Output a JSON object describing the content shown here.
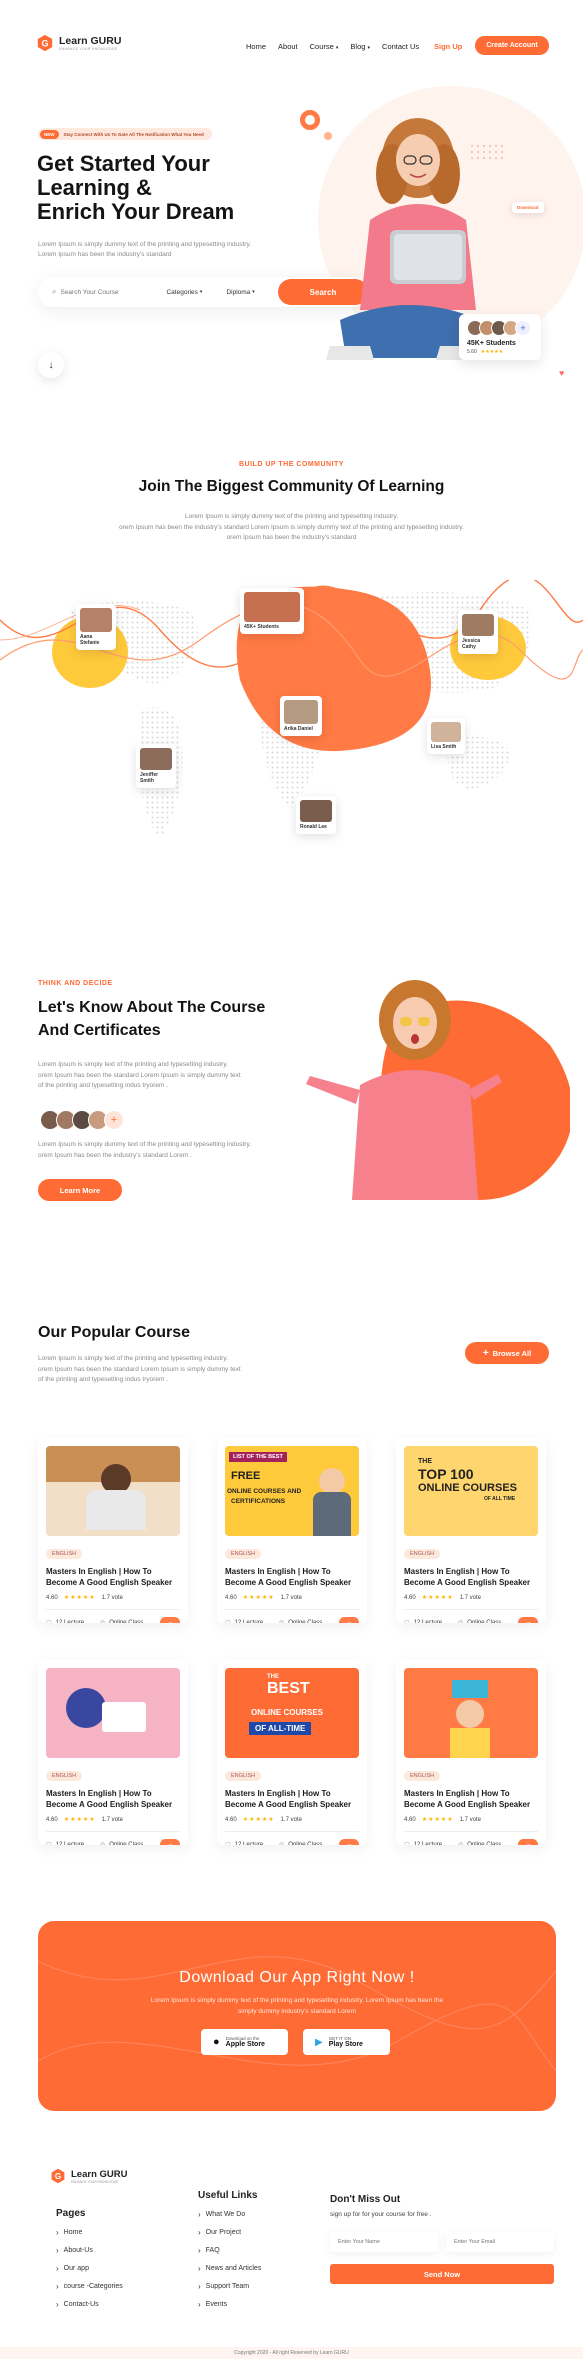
{
  "brand": {
    "name": "Learn GURU",
    "tagline": "ENHANCE YOUR KNOWLEDGE"
  },
  "nav": {
    "items": [
      {
        "label": "Home"
      },
      {
        "label": "About"
      },
      {
        "label": "Course",
        "dropdown": true
      },
      {
        "label": "Blog",
        "dropdown": true
      },
      {
        "label": "Contact Us"
      }
    ],
    "signup": "Sign Up",
    "create_account": "Create Account"
  },
  "hero": {
    "pill_tag": "NEW",
    "pill_text": "Stay Connect With Us To Gate All The Notification What You Need",
    "title_line1": "Get Started Your",
    "title_line2": "Learning &",
    "title_line3": "Enrich Your Dream",
    "desc_line1": "Lorem Ipsum is simply dummy text of the printing and typesetting industry.",
    "desc_line2": "Lorem Ipsum has been the industry's standard",
    "search_placeholder": "Search Your Course",
    "categories_label": "Categories",
    "diploma_label": "Diploma",
    "search_button": "Search",
    "students_count": "45K+ Students",
    "students_rating": "5.60",
    "floating_badge": "Download"
  },
  "community": {
    "kicker": "BUILD UP THE COMMUNITY",
    "title": "Join The Biggest Community Of Learning",
    "desc_line1": "Lorem Ipsum is simply dummy text of the printing and typesetting industry.",
    "desc_line2": "orem Ipsum has been the industry's standard Lorem Ipsum is simply dummy text of the printing and typesetting industry.",
    "desc_line3": "orem Ipsum has been the industry's standard",
    "pins": [
      {
        "name": "Aana Stefanie",
        "role": "Designer"
      },
      {
        "name": "45K+ Students",
        "role": ""
      },
      {
        "name": "Arika Daniel",
        "role": "Student"
      },
      {
        "name": "Jessica Cathy",
        "role": "Teacher"
      },
      {
        "name": "Jeniffer Smith",
        "role": "Student"
      },
      {
        "name": "Lisa Smith",
        "role": "Student"
      },
      {
        "name": "Ronald Lee",
        "role": "Student"
      }
    ]
  },
  "about": {
    "kicker": "THINK AND DECIDE",
    "title_line1": "Let's Know About The Course",
    "title_line2": "And Certificates",
    "desc1_line1": "Lorem Ipsum is simply text of the printing and typesetting industry.",
    "desc1_line2": "orem Ipsum has been the standard Lorem Ipsum is simply dummy text",
    "desc1_line3": "of the printing and typesetting indus tryorem .",
    "desc2_line1": "Lorem Ipsum is simply dummy text of the printing and typesetting industry.",
    "desc2_line2": "orem Ipsum has been the industry's standard Lorem .",
    "button": "Learn More"
  },
  "popular": {
    "title": "Our Popular Course",
    "desc_line1": "Lorem Ipsum is simply text of the printing and typesetting industry.",
    "desc_line2": "orem Ipsum has been the standard Lorem Ipsum is simply dummy text",
    "desc_line3": "of the printing and typesetting indus tryorem .",
    "browse_button": "Browse All",
    "courses": [
      {
        "badge": "ENGLISH",
        "title1": "Masters In English | How To",
        "title2": "Become A Good English Speaker",
        "rating": "4.60",
        "stars": "★★★★★",
        "votes": "1.7 vote",
        "lectures": "12 Lecture",
        "mode": "Online Class",
        "thumb": "study"
      },
      {
        "badge": "ENGLISH",
        "title1": "Masters In English | How To",
        "title2": "Become A Good English Speaker",
        "rating": "4.60",
        "stars": "★★★★★",
        "votes": "1.7 vote",
        "lectures": "12 Lecture",
        "mode": "Online Class",
        "thumb": "free",
        "thumb_text1": "LIST OF THE BEST",
        "thumb_text2": "FREE",
        "thumb_text3": "ONLINE COURSES AND",
        "thumb_text4": "CERTIFICATIONS"
      },
      {
        "badge": "ENGLISH",
        "title1": "Masters In English | How To",
        "title2": "Become A Good English Speaker",
        "rating": "4.60",
        "stars": "★★★★★",
        "votes": "1.7 vote",
        "lectures": "12 Lecture",
        "mode": "Online Class",
        "thumb": "top100",
        "thumb_text1": "THE",
        "thumb_text2": "TOP 100",
        "thumb_text3": "ONLINE COURSES",
        "thumb_text4": "OF ALL TIME"
      },
      {
        "badge": "ENGLISH",
        "title1": "Masters In English | How To",
        "title2": "Become A Good English Speaker",
        "rating": "4.60",
        "stars": "★★★★★",
        "votes": "1.7 vote",
        "lectures": "12 Lecture",
        "mode": "Online Class",
        "thumb": "laptop"
      },
      {
        "badge": "ENGLISH",
        "title1": "Masters In English | How To",
        "title2": "Become A Good English Speaker",
        "rating": "4.60",
        "stars": "★★★★★",
        "votes": "1.7 vote",
        "lectures": "12 Lecture",
        "mode": "Online Class",
        "thumb": "best",
        "thumb_text1": "THE",
        "thumb_text2": "BEST",
        "thumb_text3": "ONLINE COURSES",
        "thumb_text4": "OF ALL-TIME"
      },
      {
        "badge": "ENGLISH",
        "title1": "Masters In English | How To",
        "title2": "Become A Good English Speaker",
        "rating": "4.60",
        "stars": "★★★★★",
        "votes": "1.7 vote",
        "lectures": "12 Lecture",
        "mode": "Online Class",
        "thumb": "books"
      }
    ]
  },
  "app": {
    "title": "Download Our App Right Now !",
    "desc_line1": "Lorem Ipsum is simply dummy text of the printing and typesetting industry. Lorem Ipsum has been the",
    "desc_line2": "simply dummy industry's standard Lorem",
    "apple_small": "Download on the",
    "apple_big": "Apple Store",
    "play_small": "GET IT ON",
    "play_big": "Play Store"
  },
  "footer": {
    "pages_title": "Pages",
    "pages": [
      "Home",
      "About-Us",
      "Our app",
      "course -Categories",
      "Contact-Us"
    ],
    "links_title": "Useful Links",
    "links": [
      "What We Do",
      "Our Project",
      "FAQ",
      "News and Articles",
      "Support Team",
      "Events"
    ],
    "news_title": "Don't Miss Out",
    "news_desc": "sign up for for your course for free .",
    "name_placeholder": "Enter Your Name",
    "email_placeholder": "Enter Your Email",
    "send_button": "Send Now",
    "copyright": "Copyright 2020 - All right Reserved by Learn GURU"
  },
  "colors": {
    "accent": "#ff6b35",
    "accent_light": "#ffe5d9",
    "yellow": "#ffc93c"
  }
}
